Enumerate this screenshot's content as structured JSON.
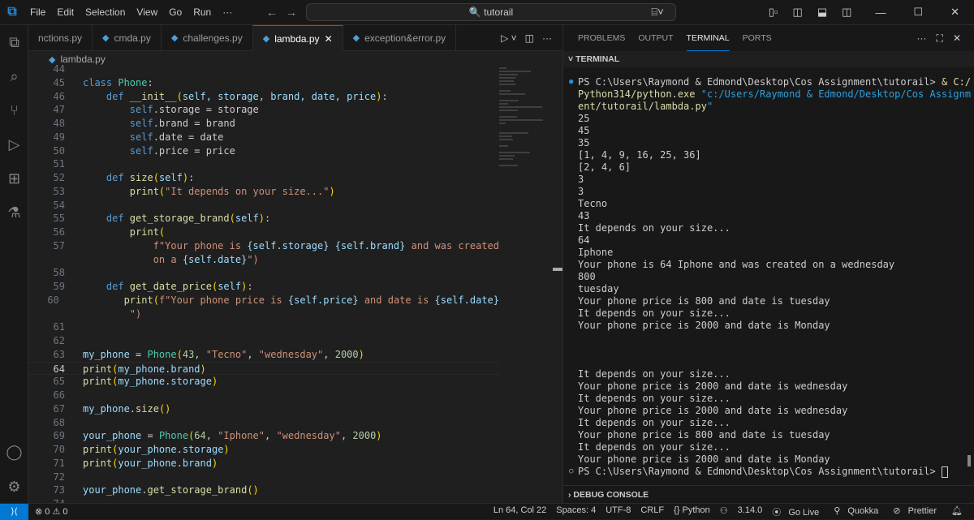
{
  "title": {
    "menu": [
      "File",
      "Edit",
      "Selection",
      "View",
      "Go",
      "Run",
      "···"
    ],
    "search": "tutorail"
  },
  "tabs": [
    {
      "label": "nctions.py"
    },
    {
      "label": "cmda.py"
    },
    {
      "label": "challenges.py"
    },
    {
      "label": "lambda.py",
      "active": true
    },
    {
      "label": "exception&error.py"
    }
  ],
  "breadcrumb": "lambda.py",
  "editor": {
    "lines": [
      {
        "n": "44",
        "t": []
      },
      {
        "n": "45",
        "t": [
          [
            "class ",
            "kw"
          ],
          [
            "Phone",
            "cls"
          ],
          [
            ":",
            "plain"
          ]
        ]
      },
      {
        "n": "46",
        "t": [
          [
            "    def ",
            "kw"
          ],
          [
            "__init__",
            "fn"
          ],
          [
            "(",
            "br"
          ],
          [
            "self, storage, brand, date, price",
            "prm"
          ],
          [
            ")",
            "br"
          ],
          [
            ":",
            "plain"
          ]
        ]
      },
      {
        "n": "47",
        "t": [
          [
            "        self",
            "sf"
          ],
          [
            ".storage = storage",
            "plain"
          ]
        ]
      },
      {
        "n": "48",
        "t": [
          [
            "        self",
            "sf"
          ],
          [
            ".brand = brand",
            "plain"
          ]
        ]
      },
      {
        "n": "49",
        "t": [
          [
            "        self",
            "sf"
          ],
          [
            ".date = date",
            "plain"
          ]
        ]
      },
      {
        "n": "50",
        "t": [
          [
            "        self",
            "sf"
          ],
          [
            ".price = price",
            "plain"
          ]
        ]
      },
      {
        "n": "51",
        "t": []
      },
      {
        "n": "52",
        "t": [
          [
            "    def ",
            "kw"
          ],
          [
            "size",
            "fn"
          ],
          [
            "(",
            "br"
          ],
          [
            "self",
            "prm"
          ],
          [
            ")",
            "br"
          ],
          [
            ":",
            "plain"
          ]
        ]
      },
      {
        "n": "53",
        "t": [
          [
            "        print",
            "fn"
          ],
          [
            "(",
            "br"
          ],
          [
            "\"It depends on your size...\"",
            "str"
          ],
          [
            ")",
            "br"
          ]
        ]
      },
      {
        "n": "54",
        "t": []
      },
      {
        "n": "55",
        "t": [
          [
            "    def ",
            "kw"
          ],
          [
            "get_storage_brand",
            "fn"
          ],
          [
            "(",
            "br"
          ],
          [
            "self",
            "prm"
          ],
          [
            ")",
            "br"
          ],
          [
            ":",
            "plain"
          ]
        ]
      },
      {
        "n": "56",
        "t": [
          [
            "        print",
            "fn"
          ],
          [
            "(",
            "br"
          ]
        ]
      },
      {
        "n": "57",
        "t": [
          [
            "            f\"Your phone is ",
            "str"
          ],
          [
            "{self.storage}",
            "var"
          ],
          [
            " ",
            "str"
          ],
          [
            "{self.brand}",
            "var"
          ],
          [
            " and was created",
            "str"
          ]
        ]
      },
      {
        "n": "",
        "t": [
          [
            "            on a ",
            "str"
          ],
          [
            "{self.date}",
            "var"
          ],
          [
            "\")",
            "str"
          ]
        ]
      },
      {
        "n": "58",
        "t": []
      },
      {
        "n": "59",
        "t": [
          [
            "    def ",
            "kw"
          ],
          [
            "get_date_price",
            "fn"
          ],
          [
            "(",
            "br"
          ],
          [
            "self",
            "prm"
          ],
          [
            ")",
            "br"
          ],
          [
            ":",
            "plain"
          ]
        ]
      },
      {
        "n": "60",
        "t": [
          [
            "        print",
            "fn"
          ],
          [
            "(",
            "br"
          ],
          [
            "f\"Your phone price is ",
            "str"
          ],
          [
            "{self.price}",
            "var"
          ],
          [
            " and date is ",
            "str"
          ],
          [
            "{self.date}",
            "var"
          ]
        ]
      },
      {
        "n": "",
        "t": [
          [
            "        \")",
            "str"
          ]
        ]
      },
      {
        "n": "61",
        "t": []
      },
      {
        "n": "62",
        "t": []
      },
      {
        "n": "63",
        "t": [
          [
            "my_phone",
            "var"
          ],
          [
            " = ",
            "plain"
          ],
          [
            "Phone",
            "cls"
          ],
          [
            "(",
            "br"
          ],
          [
            "43",
            "num2"
          ],
          [
            ", ",
            "plain"
          ],
          [
            "\"Tecno\"",
            "str"
          ],
          [
            ", ",
            "plain"
          ],
          [
            "\"wednesday\"",
            "str"
          ],
          [
            ", ",
            "plain"
          ],
          [
            "2000",
            "num2"
          ],
          [
            ")",
            "br"
          ]
        ]
      },
      {
        "n": "64",
        "t": [
          [
            "print",
            "fn"
          ],
          [
            "(",
            "br"
          ],
          [
            "my_phone",
            "var"
          ],
          [
            ".",
            "plain"
          ],
          [
            "brand",
            "var"
          ],
          [
            ")",
            "br"
          ]
        ],
        "current": true
      },
      {
        "n": "65",
        "t": [
          [
            "print",
            "fn"
          ],
          [
            "(",
            "br"
          ],
          [
            "my_phone",
            "var"
          ],
          [
            ".",
            "plain"
          ],
          [
            "storage",
            "var"
          ],
          [
            ")",
            "br"
          ]
        ]
      },
      {
        "n": "66",
        "t": []
      },
      {
        "n": "67",
        "t": [
          [
            "my_phone",
            "var"
          ],
          [
            ".",
            "plain"
          ],
          [
            "size",
            "fn"
          ],
          [
            "()",
            "br"
          ]
        ]
      },
      {
        "n": "68",
        "t": []
      },
      {
        "n": "69",
        "t": [
          [
            "your_phone",
            "var"
          ],
          [
            " = ",
            "plain"
          ],
          [
            "Phone",
            "cls"
          ],
          [
            "(",
            "br"
          ],
          [
            "64",
            "num2"
          ],
          [
            ", ",
            "plain"
          ],
          [
            "\"Iphone\"",
            "str"
          ],
          [
            ", ",
            "plain"
          ],
          [
            "\"wednesday\"",
            "str"
          ],
          [
            ", ",
            "plain"
          ],
          [
            "2000",
            "num2"
          ],
          [
            ")",
            "br"
          ]
        ]
      },
      {
        "n": "70",
        "t": [
          [
            "print",
            "fn"
          ],
          [
            "(",
            "br"
          ],
          [
            "your_phone",
            "var"
          ],
          [
            ".",
            "plain"
          ],
          [
            "storage",
            "var"
          ],
          [
            ")",
            "br"
          ]
        ]
      },
      {
        "n": "71",
        "t": [
          [
            "print",
            "fn"
          ],
          [
            "(",
            "br"
          ],
          [
            "your_phone",
            "var"
          ],
          [
            ".",
            "plain"
          ],
          [
            "brand",
            "var"
          ],
          [
            ")",
            "br"
          ]
        ]
      },
      {
        "n": "72",
        "t": []
      },
      {
        "n": "73",
        "t": [
          [
            "your_phone",
            "var"
          ],
          [
            ".",
            "plain"
          ],
          [
            "get_storage_brand",
            "fn"
          ],
          [
            "()",
            "br"
          ]
        ]
      },
      {
        "n": "74",
        "t": []
      }
    ]
  },
  "panel": {
    "tabs": [
      "PROBLEMS",
      "OUTPUT",
      "TERMINAL",
      "PORTS"
    ],
    "section": "TERMINAL",
    "debug": "DEBUG CONSOLE"
  },
  "terminal": {
    "prompt_cmd": [
      "PS C:\\Users\\Raymond & Edmond\\Desktop\\Cos Assignment\\tutorail> & C:/",
      "Python314/python.exe \"c:/Users/Raymond & Edmond/Desktop/Cos Assignm",
      "ent/tutorail/lambda.py\""
    ],
    "output": [
      "25",
      "45",
      "35",
      "[1, 4, 9, 16, 25, 36]",
      "[2, 4, 6]",
      "3",
      "3",
      "Tecno",
      "43",
      "It depends on your size...",
      "64",
      "Iphone",
      "Your phone is 64 Iphone and was created on a wednesday",
      "800",
      "tuesday",
      "Your phone price is 800 and date is tuesday",
      "It depends on your size...",
      "Your phone price is 2000 and date is Monday",
      "",
      "",
      "",
      "It depends on your size...",
      "Your phone price is 2000 and date is wednesday",
      "It depends on your size...",
      "Your phone price is 2000 and date is wednesday",
      "It depends on your size...",
      "Your phone price is 800 and date is tuesday",
      "It depends on your size...",
      "Your phone price is 2000 and date is Monday"
    ],
    "final_prompt": "PS C:\\Users\\Raymond & Edmond\\Desktop\\Cos Assignment\\tutorail> "
  },
  "status": {
    "errors": "0",
    "warnings": "0",
    "position": "Ln 64, Col 22",
    "spaces": "Spaces: 4",
    "encoding": "UTF-8",
    "eol": "CRLF",
    "language": "{} Python",
    "version": "3.14.0",
    "golive": "Go Live",
    "quokka": "Quokka",
    "prettier": "Prettier"
  }
}
